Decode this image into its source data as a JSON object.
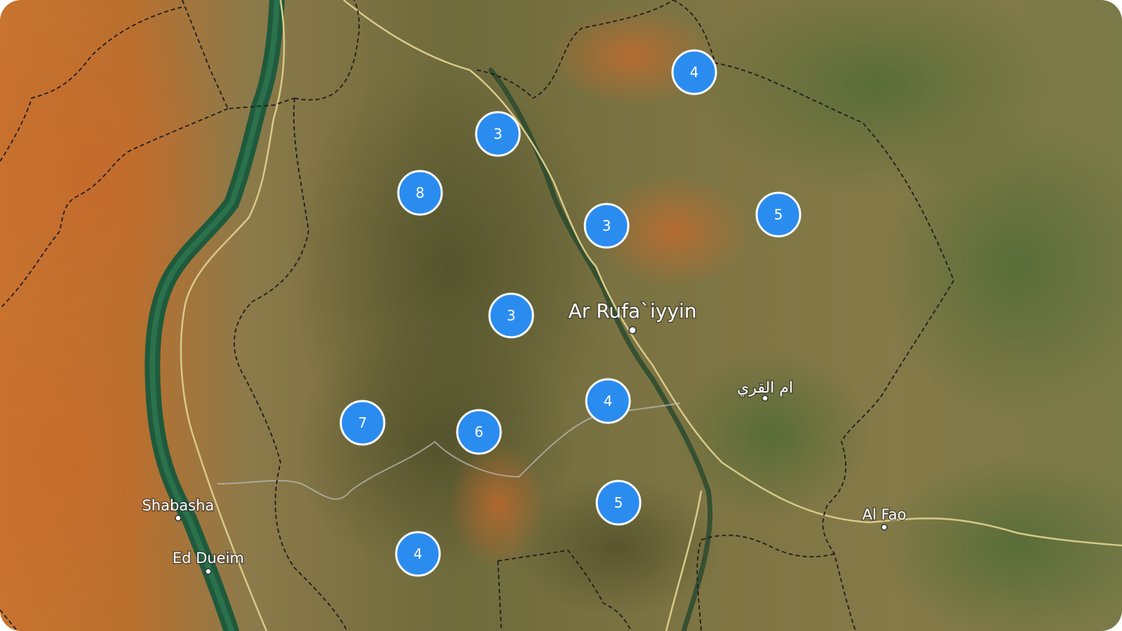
{
  "map": {
    "places": {
      "ar_rufaiyyin": "Ar Rufa`iyyin",
      "umm_al_qura": "ام القري",
      "shabasha": "Shabasha",
      "ed_dueim": "Ed Dueim",
      "al_fao": "Al Fao"
    },
    "clusters": [
      {
        "id": "c1",
        "count": "4"
      },
      {
        "id": "c2",
        "count": "3"
      },
      {
        "id": "c3",
        "count": "8"
      },
      {
        "id": "c4",
        "count": "3"
      },
      {
        "id": "c5",
        "count": "5"
      },
      {
        "id": "c6",
        "count": "3"
      },
      {
        "id": "c7",
        "count": "4"
      },
      {
        "id": "c8",
        "count": "7"
      },
      {
        "id": "c9",
        "count": "6"
      },
      {
        "id": "c10",
        "count": "5"
      },
      {
        "id": "c11",
        "count": "4"
      }
    ],
    "colors": {
      "cluster_fill": "#2b8cf0",
      "cluster_stroke": "#ffffff",
      "river": "#1f5a3c",
      "road": "#d8c98a",
      "border": "#1e1e1e"
    }
  }
}
